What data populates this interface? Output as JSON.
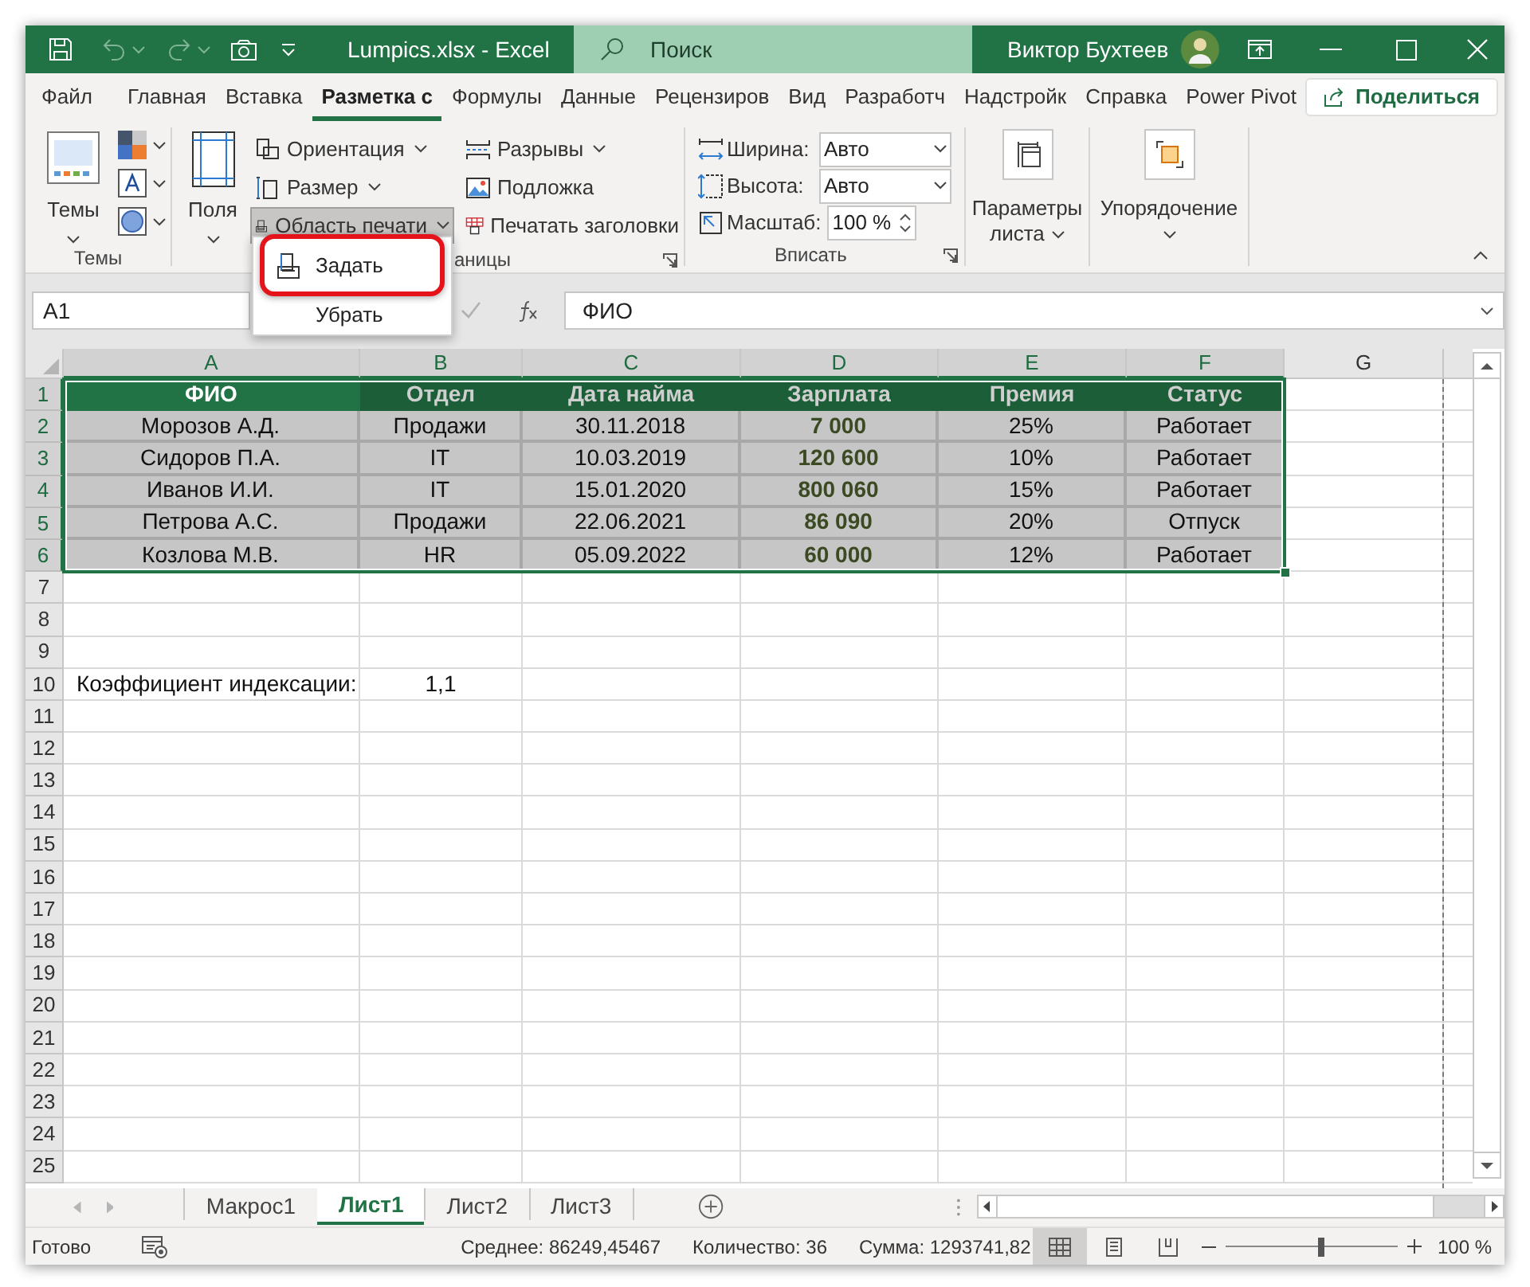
{
  "title_bar": {
    "title": "Lumpics.xlsx - Excel",
    "search_placeholder": "Поиск",
    "user": "Виктор Бухтеев"
  },
  "tabs": [
    {
      "label": "Файл",
      "selected": false
    },
    {
      "label": "Главная",
      "selected": false
    },
    {
      "label": "Вставка",
      "selected": false
    },
    {
      "label": "Разметка с",
      "selected": true
    },
    {
      "label": "Формулы",
      "selected": false
    },
    {
      "label": "Данные",
      "selected": false
    },
    {
      "label": "Рецензиров",
      "selected": false
    },
    {
      "label": "Вид",
      "selected": false
    },
    {
      "label": "Разработч",
      "selected": false
    },
    {
      "label": "Надстройк",
      "selected": false
    },
    {
      "label": "Справка",
      "selected": false
    },
    {
      "label": "Power Pivot",
      "selected": false
    }
  ],
  "share_button": "Поделиться",
  "ribbon": {
    "groups": [
      {
        "kind": "themes",
        "label": "Темы",
        "button": "Темы"
      },
      {
        "kind": "page_setup",
        "label": "аницы",
        "button": "Поля",
        "commands": [
          {
            "label": "Ориентация",
            "dropdown": true,
            "expanded": false
          },
          {
            "label": "Размер",
            "dropdown": true,
            "expanded": false
          },
          {
            "label": "Область печати",
            "dropdown": true,
            "expanded": true
          },
          {
            "label": "Разрывы",
            "dropdown": true,
            "expanded": false
          },
          {
            "label": "Подложка",
            "dropdown": false,
            "expanded": false
          },
          {
            "label": "Печатать заголовки",
            "dropdown": false,
            "expanded": false
          }
        ]
      },
      {
        "kind": "fit",
        "label": "Вписать",
        "fields": [
          {
            "kind": "dropdown",
            "label": "Ширина:",
            "value": "Авто"
          },
          {
            "kind": "dropdown",
            "label": "Высота:",
            "value": "Авто"
          },
          {
            "kind": "spinner",
            "label": "Масштаб:",
            "value": "100 %"
          }
        ]
      },
      {
        "kind": "sheet_options",
        "button": "Параметры листа"
      },
      {
        "kind": "arrange",
        "button": "Упорядочение"
      }
    ]
  },
  "print_area_menu": {
    "items": [
      {
        "kind": "icon",
        "label": "Задать",
        "selected": true
      },
      {
        "kind": "text",
        "label": "Убрать",
        "selected": false
      }
    ]
  },
  "formula_bar": {
    "name_box": "A1",
    "formula": "ФИО"
  },
  "sheet": {
    "columns": [
      {
        "label": "A",
        "selected": true,
        "bold": false
      },
      {
        "label": "B",
        "selected": true,
        "bold": false
      },
      {
        "label": "C",
        "selected": true,
        "bold": false
      },
      {
        "label": "D",
        "selected": true,
        "bold": true
      },
      {
        "label": "E",
        "selected": true,
        "bold": false
      },
      {
        "label": "F",
        "selected": true,
        "bold": false
      },
      {
        "label": "G",
        "selected": false,
        "bold": false
      }
    ],
    "rows": [
      {
        "number": "1",
        "kind": "header",
        "selected": true,
        "cells": [
          "ФИО",
          "Отдел",
          "Дата найма",
          "Зарплата",
          "Премия",
          "Статус"
        ]
      },
      {
        "number": "2",
        "kind": "data",
        "selected": true,
        "cells": [
          "Морозов А.Д.",
          "Продажи",
          "30.11.2018",
          "7 000",
          "25%",
          "Работает"
        ]
      },
      {
        "number": "3",
        "kind": "data",
        "selected": true,
        "cells": [
          "Сидоров П.А.",
          "IT",
          "10.03.2019",
          "120 600",
          "10%",
          "Работает"
        ]
      },
      {
        "number": "4",
        "kind": "data",
        "selected": true,
        "cells": [
          "Иванов И.И.",
          "IT",
          "15.01.2020",
          "800 060",
          "15%",
          "Работает"
        ]
      },
      {
        "number": "5",
        "kind": "data",
        "selected": true,
        "cells": [
          "Петрова А.С.",
          "Продажи",
          "22.06.2021",
          "86 090",
          "20%",
          "Отпуск"
        ]
      },
      {
        "number": "6",
        "kind": "data",
        "selected": true,
        "cells": [
          "Козлова М.В.",
          "HR",
          "05.09.2022",
          "60 000",
          "12%",
          "Работает"
        ]
      },
      {
        "number": "7",
        "kind": "empty",
        "selected": false
      },
      {
        "number": "8",
        "kind": "empty",
        "selected": false
      },
      {
        "number": "9",
        "kind": "empty",
        "selected": false
      },
      {
        "number": "10",
        "kind": "plain",
        "selected": false,
        "cells": [
          "Коэффициент индексации:",
          "1,1"
        ]
      },
      {
        "number": "11",
        "kind": "empty",
        "selected": false
      },
      {
        "number": "12",
        "kind": "empty",
        "selected": false
      },
      {
        "number": "13",
        "kind": "empty",
        "selected": false
      },
      {
        "number": "14",
        "kind": "empty",
        "selected": false
      },
      {
        "number": "15",
        "kind": "empty",
        "selected": false
      },
      {
        "number": "16",
        "kind": "empty",
        "selected": false
      },
      {
        "number": "17",
        "kind": "empty",
        "selected": false
      },
      {
        "number": "18",
        "kind": "empty",
        "selected": false
      },
      {
        "number": "19",
        "kind": "empty",
        "selected": false
      },
      {
        "number": "20",
        "kind": "empty",
        "selected": false
      },
      {
        "number": "21",
        "kind": "empty",
        "selected": false
      },
      {
        "number": "22",
        "kind": "empty",
        "selected": false
      },
      {
        "number": "23",
        "kind": "empty",
        "selected": false
      },
      {
        "number": "24",
        "kind": "empty",
        "selected": false
      },
      {
        "number": "25",
        "kind": "empty",
        "selected": false
      }
    ]
  },
  "sheet_tabs": [
    {
      "label": "Макрос1",
      "selected": false
    },
    {
      "label": "Лист1",
      "selected": true
    },
    {
      "label": "Лист2",
      "selected": false
    },
    {
      "label": "Лист3",
      "selected": false
    }
  ],
  "status_bar": {
    "mode": "Готово",
    "stats": [
      "Среднее: 86249,45467",
      "Количество: 36",
      "Сумма: 1293741,82"
    ],
    "views": [
      {
        "kind": "normal",
        "selected": true
      },
      {
        "kind": "page_layout",
        "selected": false
      },
      {
        "kind": "page_break",
        "selected": false
      }
    ],
    "zoom": {
      "level": 0.56,
      "label": "100 %"
    }
  }
}
